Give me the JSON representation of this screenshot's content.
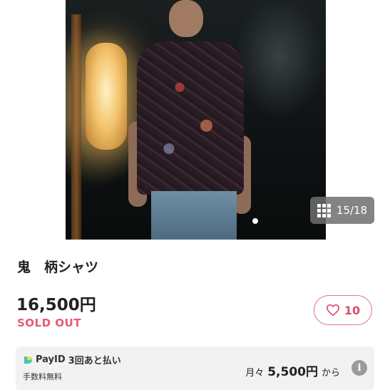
{
  "gallery": {
    "counter": "15/18",
    "icons": {
      "grid": "grid-icon"
    }
  },
  "product": {
    "title": "鬼　柄シャツ",
    "price": "16,500円",
    "status": "SOLD OUT",
    "status_color": "#e55a79"
  },
  "like": {
    "count": "10",
    "icon": "heart-icon",
    "color": "#d9506f"
  },
  "payment": {
    "brand": "PayID",
    "plan": "3回あと払い",
    "fee_note": "手数料無料",
    "monthly_label": "月々",
    "monthly_amount": "5,500円",
    "monthly_suffix": "から",
    "info_icon": "info-icon"
  }
}
